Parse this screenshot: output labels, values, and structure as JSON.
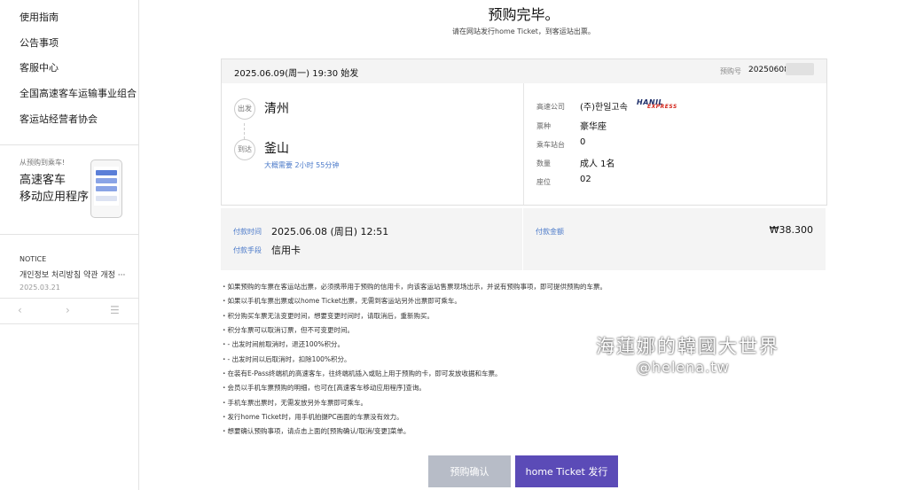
{
  "sidebar": {
    "links": [
      "使用指南",
      "公告事项",
      "客服中心",
      "全国高速客车运输事业组合",
      "客运站经营者协会"
    ],
    "promo_small": "从预购到乘车!",
    "promo_title_1": "高速客车",
    "promo_title_2": "移动应用程序",
    "notice_heading": "NOTICE",
    "notice_title": "개인정보 처리방침 약관 개정 ···",
    "notice_date": "2025.03.21",
    "pager": {
      "prev": "‹",
      "next": "›",
      "menu": "☰"
    }
  },
  "main": {
    "title": "预购完毕。",
    "subtitle": "请在网站发行home Ticket，到客运站出票。"
  },
  "ticket": {
    "departure": "2025.06.09(周一) 19:30 始发",
    "reservation_label": "预购号",
    "reservation_value": "20250608",
    "depart_badge": "出发",
    "arrive_badge": "到达",
    "origin": "清州",
    "destination": "釜山",
    "duration": "大概需要 2小时 55分钟",
    "company_label": "高速公司",
    "company_value": "(주)한일고속",
    "logo_main": "HANIL",
    "logo_sub": "EXPRESS",
    "fare_type_label": "票种",
    "fare_type_value": "豪华座",
    "platform_label": "乘车站台",
    "platform_value": "0",
    "quantity_label": "数量",
    "quantity_value": "成人 1名",
    "seat_label": "座位",
    "seat_value": "02"
  },
  "payment": {
    "time_label": "付款时间",
    "time_value": "2025.06.08 (周日) 12:51",
    "method_label": "付款手段",
    "method_value": "信用卡",
    "amount_label": "付款金额",
    "amount_value": "₩38.300"
  },
  "notes": [
    "・如果预购的车票在客运站出票，必须携带用于预购的信用卡，向该客运站售票现场出示，并说有预购事项，即可提供预购的车票。",
    "・如果以手机车票出票或以home Ticket出票，无需到客运站另外出票即可乘车。",
    "・积分购买车票无法变更时间，想要变更时间时，请取消后，重新购买。",
    "・积分车票可以取消订票，但不可变更时间。",
    "・- 出发时间前取消时，退还100%积分。",
    "・- 出发时间以后取消时，扣除100%积分。",
    "・在装有E-Pass终端机的高速客车，往终端机插入或贴上用于预购的卡，即可发放收据和车票。",
    "・会员以手机车票预购的明细，也可在[高速客车移动应用程序]查询。",
    "・手机车票出票时，无需发放另外车票即可乘车。",
    "・发行home Ticket时，用手机拍摄PC画面的车票没有效力。",
    "・想要确认预购事项，请点击上面的[预购确认/取消/变更]菜单。"
  ],
  "watermark": {
    "line1": "海蓮娜的韓國大世界",
    "line2": "@helena.tw"
  },
  "buttons": {
    "confirm": "预购确认",
    "issue": "home Ticket 发行"
  }
}
